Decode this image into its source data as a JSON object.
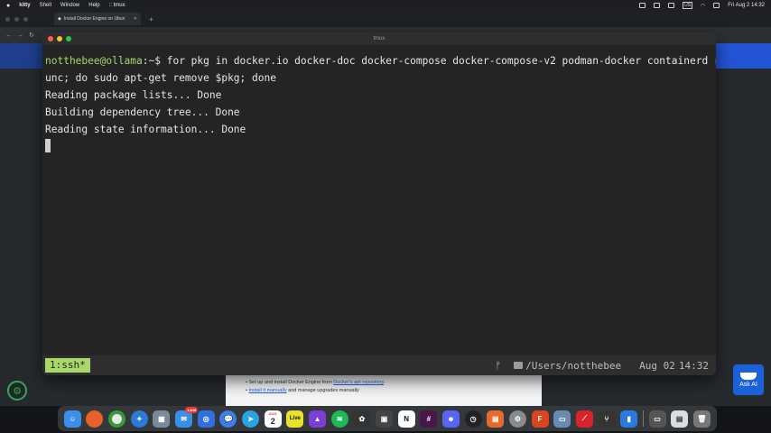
{
  "menubar": {
    "app": "kitty",
    "items": [
      "Shell",
      "Window",
      "Help",
      ":: tmux"
    ],
    "clock": "Fri Aug 2  14:32",
    "input_source": "US"
  },
  "browser": {
    "tab_title": "Install Docker Engine on Ubun",
    "page_text_1": "Set up and install Docker Engine from",
    "page_link_1": "Docker's  apt  repository",
    "page_link_2": "Install it manually",
    "page_text_2": "and manage upgrades manually",
    "ask_ai": "Ask AI"
  },
  "terminal": {
    "title": "tmux",
    "prompt_user": "notthebee@ollama",
    "prompt_rest": ":~$ ",
    "command_line1": "for pkg in docker.io docker-doc docker-compose docker-compose-v2 podman-docker containerd r",
    "command_line2": "unc; do sudo apt-get remove $pkg; done",
    "output": [
      "Reading package lists... Done",
      "Building dependency tree... Done",
      "Reading state information... Done"
    ]
  },
  "statusbar": {
    "window": "1:ssh*",
    "branch_glyph": "ᚠ",
    "path": "/Users/notthebee",
    "date": "Aug 02",
    "time": "14:32"
  },
  "dock": {
    "mail_badge": "1,848",
    "calendar_month": "AUG",
    "calendar_day": "2",
    "live_label": "Live",
    "notion_label": "N",
    "icons": [
      "finder-icon",
      "firefox-icon",
      "chrome-icon",
      "safari-icon",
      "launchpad-icon",
      "mail-icon",
      "app-icon",
      "messages-icon",
      "telegram-icon",
      "calendar-icon",
      "live-icon",
      "affinity-icon",
      "spotify-icon",
      "davinci-icon",
      "app2-icon",
      "notion-icon",
      "slack-icon",
      "discord-icon",
      "clock-icon",
      "office-icon",
      "settings-icon",
      "app3-icon",
      "preview-icon",
      "acrobat-icon",
      "git-icon",
      "terminal-icon",
      "window-icon",
      "document-icon",
      "trash-icon"
    ]
  }
}
